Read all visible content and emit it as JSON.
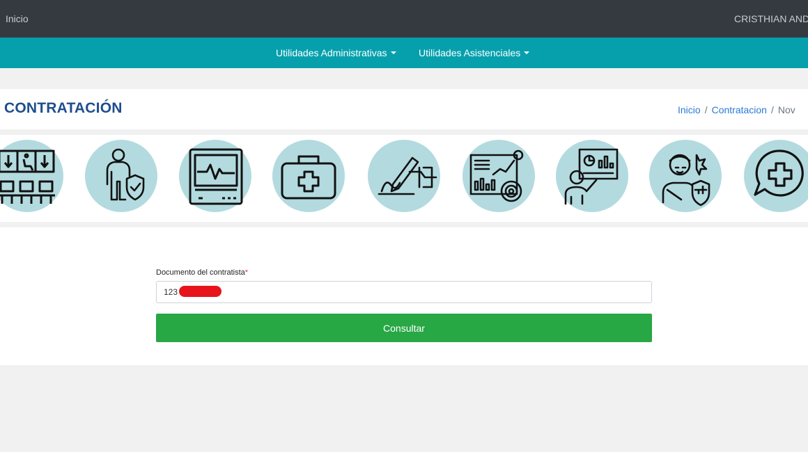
{
  "topbar": {
    "home_label": "Inicio",
    "user_name": "CRISTHIAN ANDRÉS"
  },
  "menu": {
    "items": [
      {
        "label": "Utilidades Administrativas"
      },
      {
        "label": "Utilidades Asistenciales"
      }
    ]
  },
  "page": {
    "title": "CONTRATACIÓN",
    "breadcrumb": {
      "home": "Inicio",
      "section": "Contratacion",
      "current": "Nov"
    }
  },
  "shortcuts": [
    {
      "icon": "waiting-room-icon"
    },
    {
      "icon": "protected-person-icon"
    },
    {
      "icon": "heart-monitor-icon"
    },
    {
      "icon": "first-aid-kit-icon"
    },
    {
      "icon": "signature-icon"
    },
    {
      "icon": "analytics-dashboard-icon"
    },
    {
      "icon": "presentation-icon"
    },
    {
      "icon": "injured-patient-icon"
    },
    {
      "icon": "medical-chat-icon"
    }
  ],
  "form": {
    "document_label": "Documento del contratista",
    "required_mark": "*",
    "document_value": "123",
    "submit_label": "Consultar"
  },
  "colors": {
    "topbar": "#343a40",
    "menubar": "#06a0ad",
    "title": "#1f4e8c",
    "icon_circle": "#b3dadf",
    "submit": "#28a745",
    "redaction": "#e8141b"
  }
}
